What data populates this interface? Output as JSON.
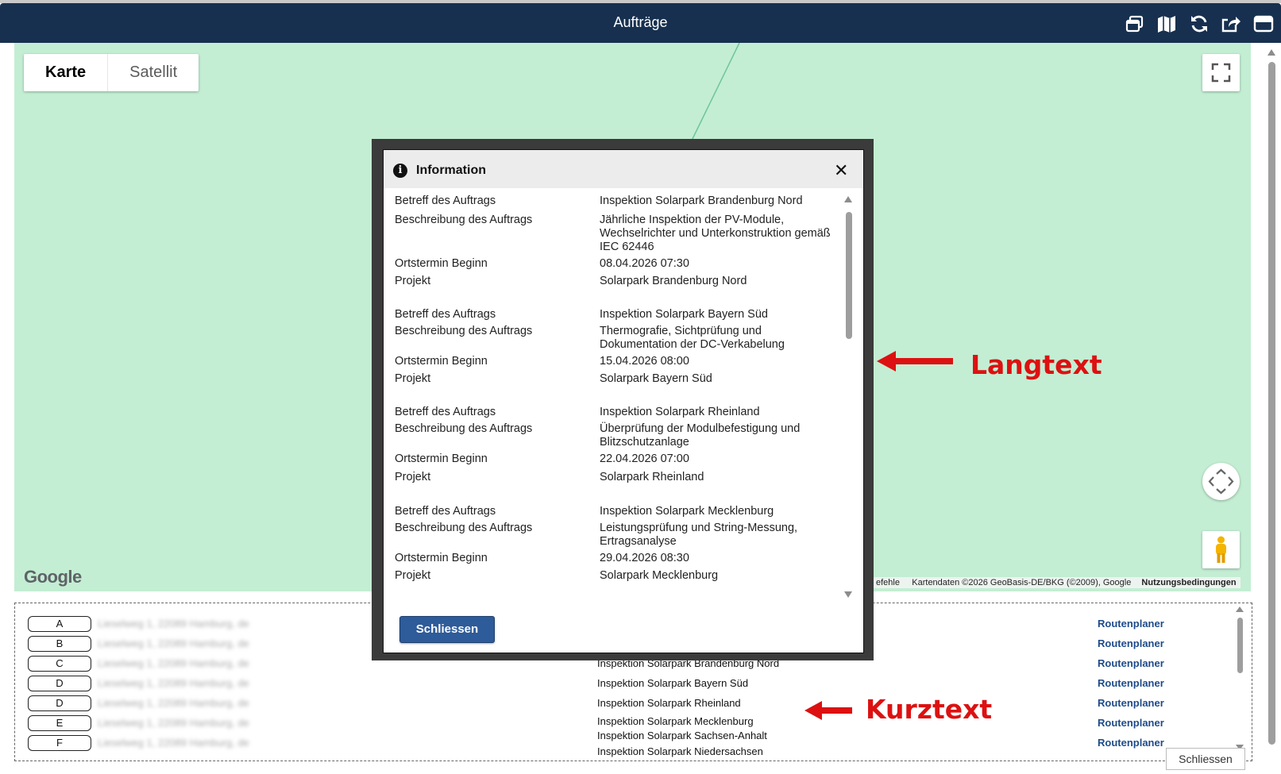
{
  "app": {
    "title": "Aufträge"
  },
  "toolbar": {
    "icons": [
      "windows-icon",
      "map-icon",
      "refresh-icon",
      "share-icon",
      "maximize-icon"
    ]
  },
  "map": {
    "type_options": [
      "Karte",
      "Satellit"
    ],
    "active_type": "Karte",
    "logo": "Google",
    "attribution_partial": "efehle",
    "attribution": "Kartendaten ©2026 GeoBasis-DE/BKG (©2009), Google",
    "terms": "Nutzungsbedingungen"
  },
  "dialog": {
    "title": "Information",
    "close_symbol": "✕",
    "button": "Schliessen",
    "labels": {
      "subject": "Betreff des Auftrags",
      "description": "Beschreibung des Auftrags",
      "start": "Ortstermin Beginn",
      "project": "Projekt"
    },
    "records": [
      {
        "subject": "Inspektion Solarpark Brandenburg Nord",
        "description": "Jährliche Inspektion der PV-Module, Wechselrichter und Unterkonstruktion gemäß IEC 62446",
        "start": "08.04.2026 07:30",
        "project": "Solarpark Brandenburg Nord"
      },
      {
        "subject": "Inspektion Solarpark Bayern Süd",
        "description": "Thermografie, Sichtprüfung und Dokumentation der DC-Verkabelung",
        "start": "15.04.2026 08:00",
        "project": "Solarpark Bayern Süd"
      },
      {
        "subject": "Inspektion Solarpark Rheinland",
        "description": "Überprüfung der Modulbefestigung und Blitzschutzanlage",
        "start": "22.04.2026 07:00",
        "project": "Solarpark Rheinland"
      },
      {
        "subject": "Inspektion Solarpark Mecklenburg",
        "description": "Leistungsprüfung und String-Messung, Ertragsanalyse",
        "start": "29.04.2026 08:30",
        "project": "Solarpark Mecklenburg"
      }
    ]
  },
  "list": {
    "route_label": "Routenplaner",
    "address_placeholder": "Lieselweg 1, 22089 Hamburg, de",
    "markers": [
      "A",
      "B",
      "C",
      "D",
      "D",
      "E",
      "F"
    ],
    "short_texts": [
      "Inspektion Solarpark Brandenburg Nord",
      "Inspektion Solarpark Bayern Süd",
      "Inspektion Solarpark Rheinland",
      "Inspektion Solarpark Mecklenburg",
      "Inspektion Solarpark Sachsen-Anhalt",
      "Inspektion Solarpark Niedersachsen"
    ],
    "close_button": "Schliessen"
  },
  "annotations": {
    "long": "Langtext",
    "short": "Kurztext",
    "color": "#dd1111"
  }
}
